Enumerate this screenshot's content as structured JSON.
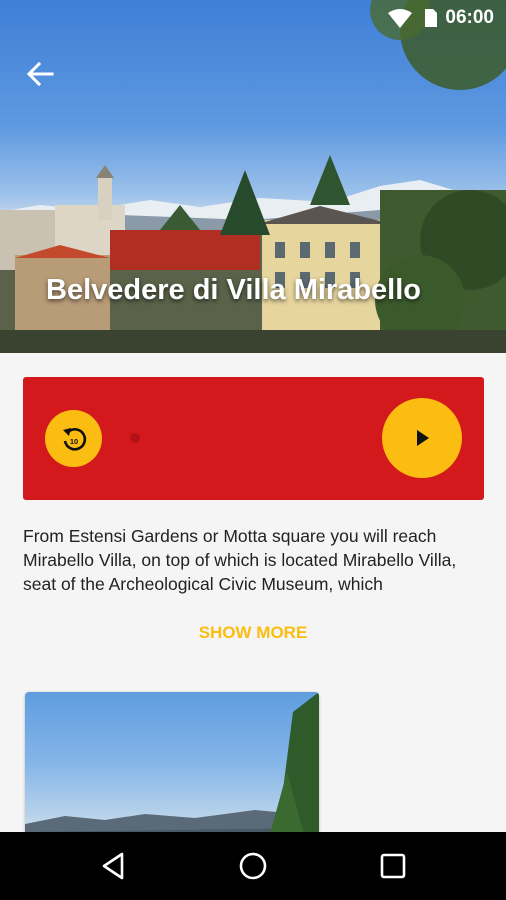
{
  "status": {
    "time": "06:00"
  },
  "hero": {
    "title": "Belvedere di Villa Mirabello"
  },
  "player": {
    "rewind_label": "10"
  },
  "description": "From Estensi Gardens or Motta square you will reach Mirabello Villa, on top of which is located Mirabello Villa, seat of the Archeological Civic Museum, which",
  "show_more_label": "SHOW MORE",
  "colors": {
    "accent": "#fbbd12",
    "player_bg": "#d3191c"
  }
}
